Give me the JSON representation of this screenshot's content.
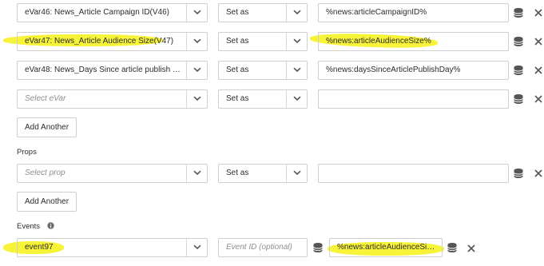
{
  "evars": [
    {
      "name": "eVar46: News_Article Campaign ID(V46)",
      "action": "Set as",
      "value": "%news:articleCampaignID%"
    },
    {
      "name": "eVar47: News_Article Audience Size(V47)",
      "action": "Set as",
      "value": "%news:articleAudienceSize%"
    },
    {
      "name": "eVar48: News_Days Since article publish da…",
      "action": "Set as",
      "value": "%news:daysSinceArticlePublishDay%"
    },
    {
      "name": "",
      "placeholder": "Select eVar",
      "action": "Set as",
      "value": ""
    }
  ],
  "add_another_label": "Add Another",
  "props_section": {
    "title": "Props",
    "row": {
      "name": "",
      "placeholder": "Select prop",
      "action": "Set as",
      "value": ""
    },
    "add_another_label": "Add Another"
  },
  "events_section": {
    "title": "Events",
    "info_icon": "info-icon",
    "row": {
      "name": "event97",
      "event_id_value": "",
      "event_id_placeholder": "Event ID (optional)",
      "value": "%news:articleAudienceSiz…"
    }
  },
  "icons": {
    "data_element": "database-icon",
    "remove": "close-icon",
    "dropdown": "chevron-down-icon"
  },
  "colors": {
    "highlight": "#f5f000",
    "border": "#cfcfcf",
    "icon": "#555555"
  }
}
